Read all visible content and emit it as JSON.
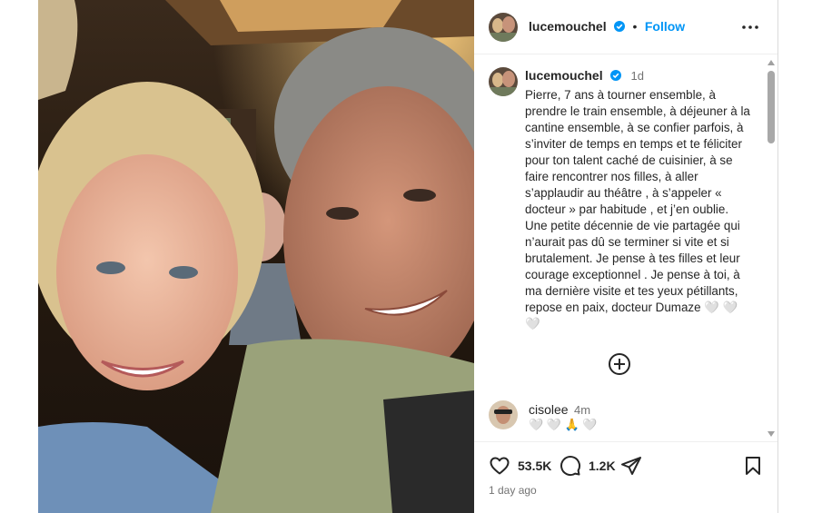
{
  "header": {
    "username": "lucemouchel",
    "separator": "•",
    "follow_label": "Follow"
  },
  "caption": {
    "username": "lucemouchel",
    "time": "1d",
    "text": "Pierre, 7 ans à tourner ensemble, à prendre le train ensemble, à déjeuner à la cantine ensemble, à se confier parfois, à s’inviter de temps en temps et te féliciter pour ton talent caché de cuisinier, à se faire rencontrer nos filles, à aller s’applaudir au théâtre , à s’appeler « docteur » par habitude , et j’en oublie. Une petite décennie de vie partagée qui n’aurait pas dû se terminer si vite et si brutalement. Je pense à tes filles et leur courage exceptionnel . Je pense à toi, à ma dernière visite et tes yeux pétillants, repose en paix, docteur Dumaze 🤍 🤍 🤍"
  },
  "comment": {
    "username": "cisolee",
    "time": "4m",
    "text": "🤍 🤍 🙏 🤍"
  },
  "actions": {
    "likes": "53.5K",
    "comments": "1.2K",
    "post_date": "1 day ago"
  },
  "colors": {
    "accent": "#0095f6",
    "verified": "#0095f6",
    "text": "#262626",
    "muted": "#737373"
  },
  "icons": {
    "like": "heart-icon",
    "comment": "comment-bubble-icon",
    "share": "paper-plane-icon",
    "save": "bookmark-icon",
    "more": "more-options-icon",
    "load_more": "plus-circle-icon",
    "verified": "verified-badge-icon"
  }
}
